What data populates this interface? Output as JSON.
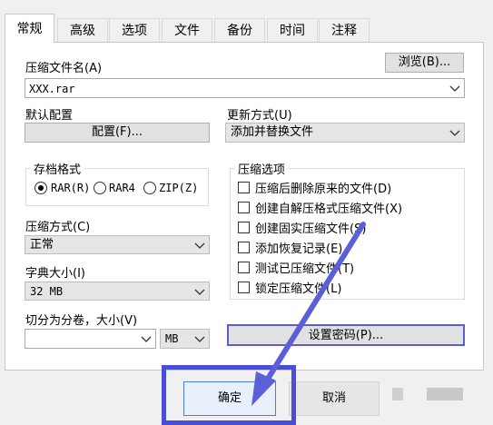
{
  "tabs": [
    {
      "label": "常规",
      "active": true
    },
    {
      "label": "高级"
    },
    {
      "label": "选项"
    },
    {
      "label": "文件"
    },
    {
      "label": "备份"
    },
    {
      "label": "时间"
    },
    {
      "label": "注释"
    }
  ],
  "archive_name": {
    "label": "压缩文件名(A)",
    "value": "XXX.rar",
    "browse_label": "浏览(B)..."
  },
  "default_profile": {
    "label": "默认配置",
    "button_label": "配置(F)..."
  },
  "update_mode": {
    "label": "更新方式(U)",
    "value": "添加并替换文件"
  },
  "archive_format": {
    "label": "存档格式",
    "options": [
      "RAR(R)",
      "RAR4",
      "ZIP(Z)"
    ],
    "selected": "RAR(R)"
  },
  "compression_method": {
    "label": "压缩方式(C)",
    "value": "正常"
  },
  "dictionary_size": {
    "label": "字典大小(I)",
    "value": "32 MB"
  },
  "split_volumes": {
    "label": "切分为分卷，大小(V)",
    "value": "",
    "unit": "MB"
  },
  "compression_options": {
    "label": "压缩选项",
    "items": [
      {
        "label": "压缩后删除原来的文件(D)",
        "checked": false
      },
      {
        "label": "创建自解压格式压缩文件(X)",
        "checked": false
      },
      {
        "label": "创建固实压缩文件(S)",
        "checked": false
      },
      {
        "label": "添加恢复记录(E)",
        "checked": false
      },
      {
        "label": "测试已压缩文件(T)",
        "checked": false
      },
      {
        "label": "锁定压缩文件(L)",
        "checked": false
      }
    ]
  },
  "set_password_label": "设置密码(P)...",
  "ok_label": "确定",
  "cancel_label": "取消",
  "colors": {
    "highlight_box": "#4a4ed6",
    "arrow": "#5b5fd8"
  }
}
